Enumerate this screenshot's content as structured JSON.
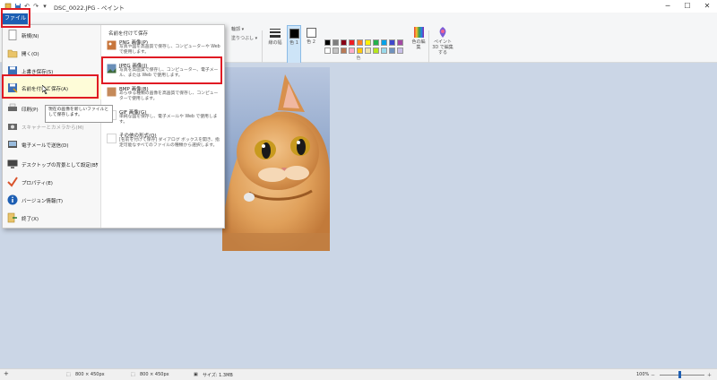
{
  "window": {
    "title": "DSC_0022.JPG - ペイント",
    "controls": {
      "minimize": "─",
      "maximize": "☐",
      "close": "✕"
    }
  },
  "ribbon": {
    "file_tab": "ファイル",
    "size_label": "線の幅",
    "color1_label": "色 1",
    "color1_num": "1",
    "color2_label": "色 2",
    "color2_num": "2",
    "edit_colors": "色の編集",
    "paint3d": "ペイント 3D で編集する",
    "colors_group": "色",
    "outline": "輪郭",
    "fill": "塗りつぶし",
    "palette": [
      "#000000",
      "#7f7f7f",
      "#880015",
      "#ed1c24",
      "#ff7f27",
      "#fff200",
      "#22b14c",
      "#00a2e8",
      "#3f48cc",
      "#a349a4",
      "#ffffff",
      "#c3c3c3",
      "#b97a57",
      "#ffaec9",
      "#ffc90e",
      "#efe4b0",
      "#b5e61d",
      "#99d9ea",
      "#7092be",
      "#c8bfe7"
    ]
  },
  "file_menu": {
    "items": [
      {
        "label": "新規(N)",
        "icon": "new-file-icon"
      },
      {
        "label": "開く(O)",
        "icon": "open-folder-icon"
      },
      {
        "label": "上書き保存(S)",
        "icon": "save-icon"
      },
      {
        "label": "名前を付けて保存(A)",
        "icon": "save-as-icon"
      },
      {
        "label": "印刷(P)",
        "icon": "print-icon"
      },
      {
        "label": "スキャナーとカメラから(M)",
        "icon": "camera-icon"
      },
      {
        "label": "電子メールで送信(D)",
        "icon": "email-icon"
      },
      {
        "label": "デスクトップの背景として設定(B)",
        "icon": "desktop-icon"
      },
      {
        "label": "プロパティ(E)",
        "icon": "checkmark-icon"
      },
      {
        "label": "バージョン情報(T)",
        "icon": "info-icon"
      },
      {
        "label": "終了(X)",
        "icon": "exit-icon"
      }
    ],
    "tooltip": "現在の画像を新しいファイルとして保存します。",
    "save_as_heading": "名前を付けて保存",
    "formats": [
      {
        "title": "PNG 画像(P)",
        "desc": "写真や図を高画質で保存し、コンピューターや Web で使用します。",
        "icon": "png-image-icon"
      },
      {
        "title": "JPEG 画像(J)",
        "desc": "写真を高画質で保存し、コンピューター、電子メール、または Web で使用します。",
        "icon": "jpeg-image-icon"
      },
      {
        "title": "BMP 画像(B)",
        "desc": "あらゆる種類の画像を高画質で保存し、コンピューターで使用します。",
        "icon": "bmp-image-icon"
      },
      {
        "title": "GIF 画像(G)",
        "desc": "単純な図を保存し、電子メールや Web で使用します。",
        "icon": "gif-image-icon"
      },
      {
        "title": "その他の形式(O)",
        "desc": "[名前を付けて保存] ダイアログ ボックスを開き、指定可能なすべてのファイルの種類から選択します。",
        "icon": "other-formats-icon"
      }
    ]
  },
  "statusbar": {
    "add": "+",
    "selection_size": "800 × 450px",
    "image_size": "800 × 450px",
    "file_size": "サイズ: 1.3MB",
    "zoom": "100%",
    "zoom_minus": "－",
    "zoom_plus": "＋"
  }
}
